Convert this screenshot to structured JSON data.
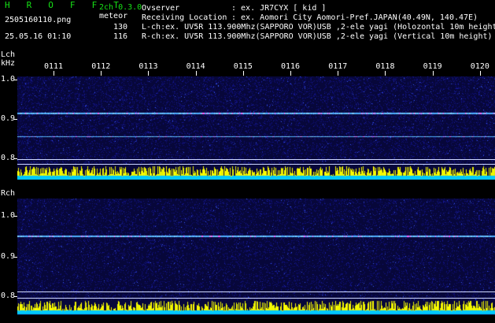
{
  "app": {
    "title": "H R O F F T",
    "channels": "2ch 0.3.0",
    "filename": "2505160110.png",
    "datetime": "25.05.16 01:10",
    "meteor_label": "meteor",
    "meteor_lch": "130",
    "meteor_rch": "116"
  },
  "info": {
    "observer_label": "Ovserver",
    "observer_value": ": ex. JR7CYX [ kid ]",
    "location_label": "Receiving Location",
    "location_value": ": ex. Aomori City Aomori-Pref.JAPAN(40.49N, 140.47E)",
    "lch_line": "L-ch:ex. UV5R 113.900Mhz(SAPPORO VOR)USB ,2-ele yagi (Holozontal 10m height)",
    "rch_line": "R-ch:ex. UV5R 113.900Mhz(SAPPORO VOR)USB ,2-ele yagi (Vertical 10m height)"
  },
  "lch": {
    "label": "Lch",
    "unit": "kHz",
    "freq_labels": [
      "1.0",
      "0.9",
      "0.8"
    ]
  },
  "rch": {
    "label": "Rch",
    "freq_labels": [
      "1.0",
      "0.9",
      "0.8"
    ]
  },
  "time_labels": [
    "0111",
    "0112",
    "0113",
    "0114",
    "0115",
    "0116",
    "0117",
    "0118",
    "0119",
    "0120"
  ],
  "colors": {
    "accent": "#16e016",
    "background": "#000000",
    "spectrum_bg": "#07073a",
    "carrier": "#4fb0ff",
    "activity_bar": "#ffff00",
    "activity_base": "#00c8ff"
  }
}
